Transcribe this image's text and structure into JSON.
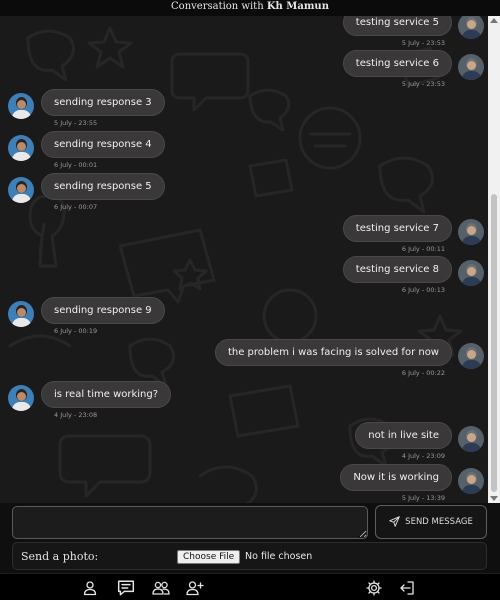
{
  "header": {
    "prefix": "Conversation with",
    "name": "Kh Mamun"
  },
  "messages": [
    {
      "side": "right",
      "text": "testing service 5",
      "time": "5 July - 23:53"
    },
    {
      "side": "right",
      "text": "testing service 6",
      "time": "5 July - 23:53"
    },
    {
      "side": "left",
      "text": "sending response 3",
      "time": "5 July - 23:55"
    },
    {
      "side": "left",
      "text": "sending response 4",
      "time": "6 July - 00:01"
    },
    {
      "side": "left",
      "text": "sending response 5",
      "time": "6 July - 00:07"
    },
    {
      "side": "right",
      "text": "testing service 7",
      "time": "6 July - 00:11"
    },
    {
      "side": "right",
      "text": "testing service 8",
      "time": "6 July - 00:13"
    },
    {
      "side": "left",
      "text": "sending response 9",
      "time": "6 July - 00:19"
    },
    {
      "side": "right",
      "text": "the problem i was facing is solved for now",
      "time": "6 July - 00:22"
    },
    {
      "side": "left",
      "text": "is real time working?",
      "time": "4 July - 23:08"
    },
    {
      "side": "right",
      "text": "not in live site",
      "time": "4 July - 23:09"
    },
    {
      "side": "right",
      "text": "Now it is working",
      "time": "5 July - 13:39"
    }
  ],
  "composer": {
    "message_value": "",
    "send_label": "SEND MESSAGE",
    "photo_label": "Send a photo:",
    "file_button": "Choose File",
    "file_status": "No file chosen"
  },
  "nav": {
    "items": [
      "profile-icon",
      "chat-icon",
      "users-icon",
      "add-user-icon",
      "settings-icon",
      "logout-icon"
    ],
    "active": "chat-icon"
  },
  "colors": {
    "background": "#1a1a1a",
    "bubble": "#3a3838",
    "bubble_border": "#4b4848",
    "timestamp": "#9a9a9a"
  }
}
